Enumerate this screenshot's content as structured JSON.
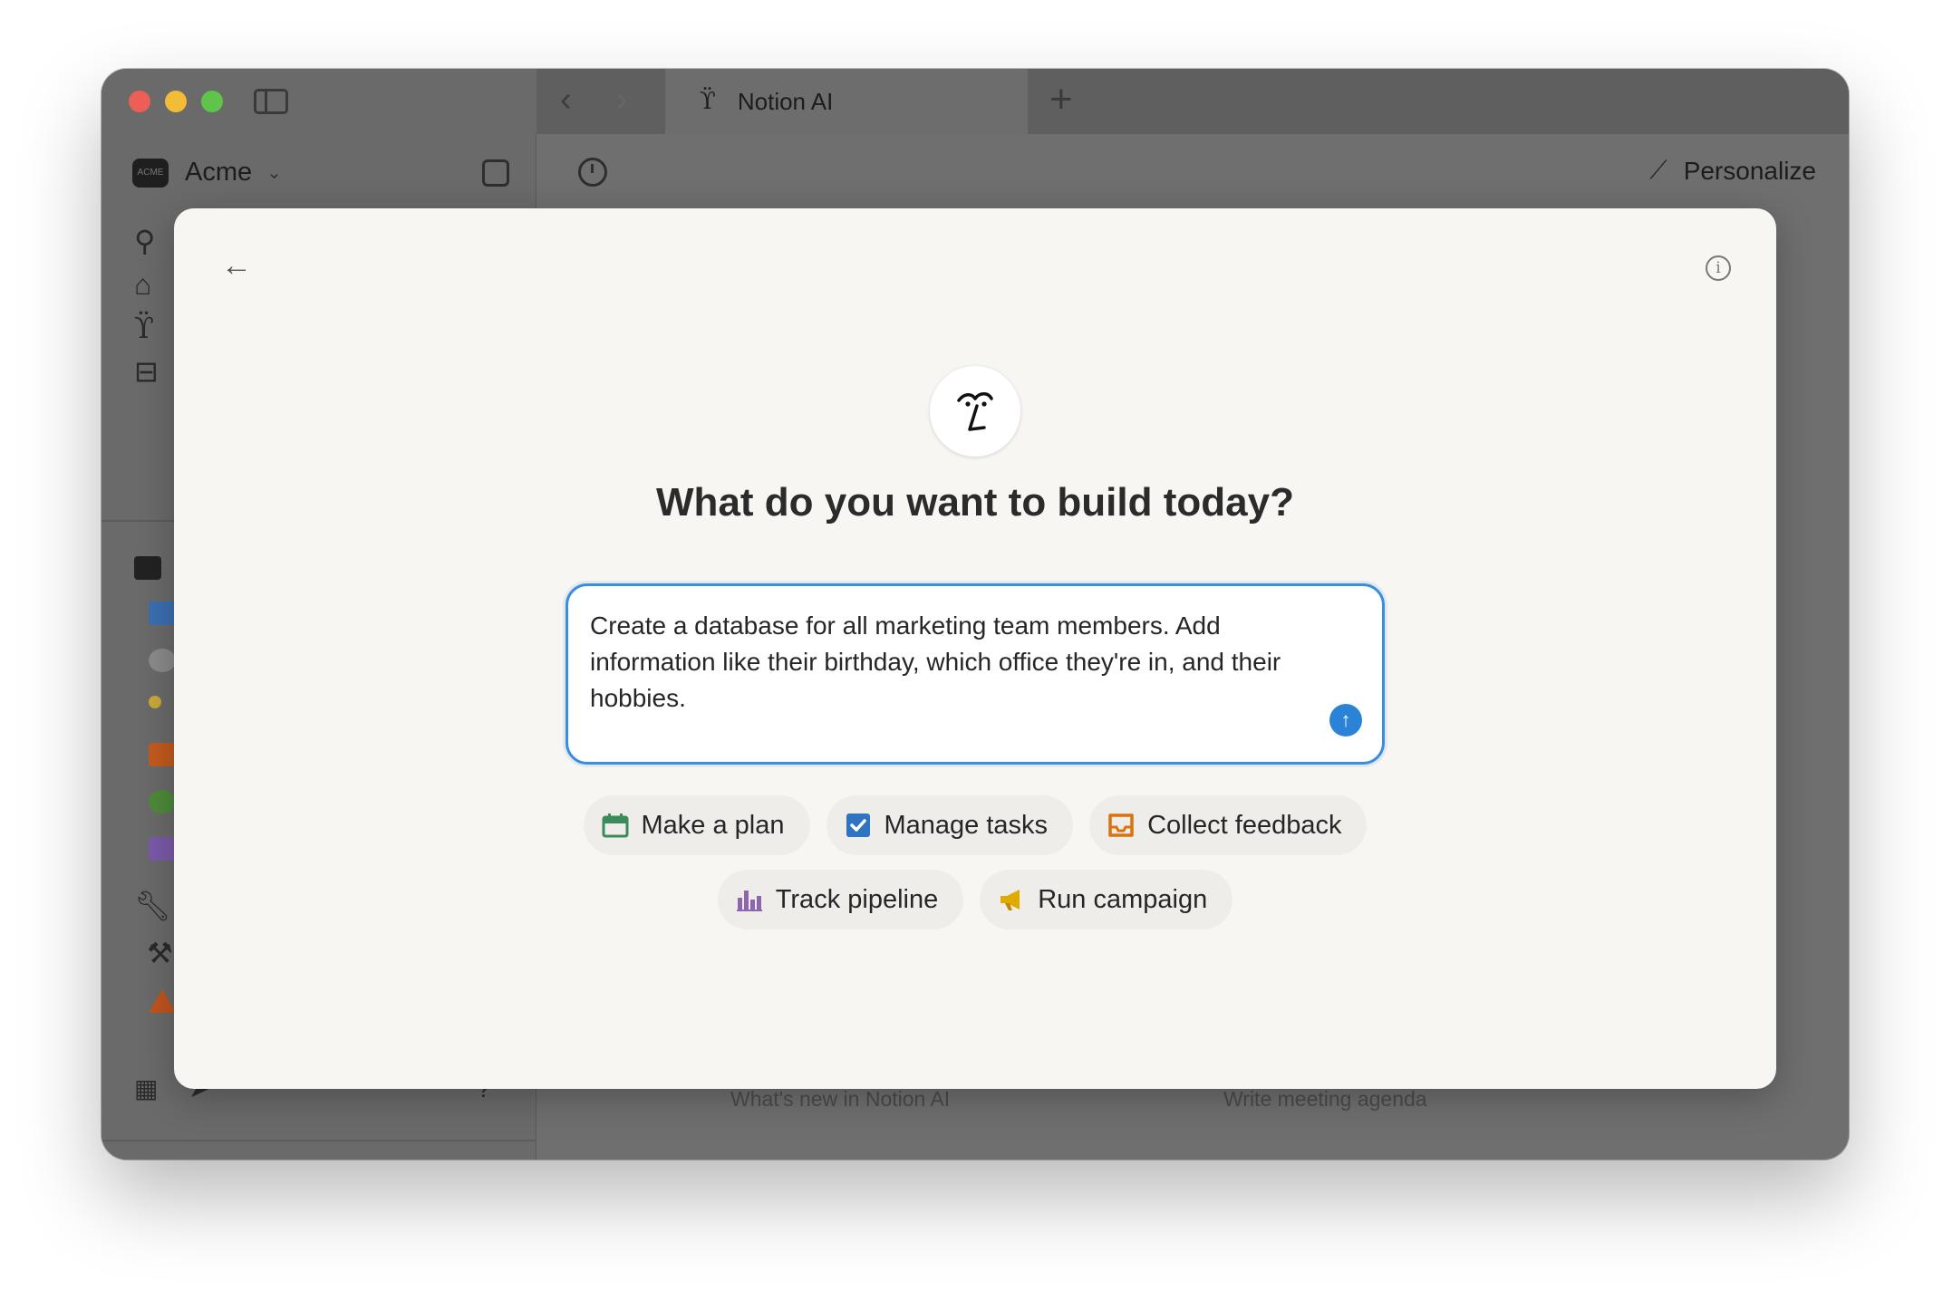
{
  "titlebar": {
    "tab_title": "Notion AI",
    "tab_icon": "notion-ai-face-icon"
  },
  "sidebar": {
    "workspace_name": "Acme",
    "workspace_logo_text": "ACME"
  },
  "header": {
    "personalize_label": "Personalize"
  },
  "background_cards": [
    {
      "label": "What's new in Notion AI"
    },
    {
      "label": "Write meeting agenda"
    }
  ],
  "modal": {
    "title": "What do you want to build today?",
    "prompt_text": "Create a database for all marketing team members. Add information like their birthday, which office they're in, and their hobbies.",
    "send_icon": "arrow-up-icon",
    "chips": [
      {
        "label": "Make a plan",
        "icon": "calendar-icon",
        "color": "#3b8a5a"
      },
      {
        "label": "Manage tasks",
        "icon": "checkbox-icon",
        "color": "#2f74c0"
      },
      {
        "label": "Collect feedback",
        "icon": "inbox-icon",
        "color": "#d9730d"
      },
      {
        "label": "Track pipeline",
        "icon": "bar-chart-icon",
        "color": "#9065b0"
      },
      {
        "label": "Run campaign",
        "icon": "megaphone-icon",
        "color": "#dfab01"
      }
    ]
  },
  "colors": {
    "accent": "#2a83d6",
    "modal_bg": "#f7f6f3",
    "overlay": "#6f6f6f"
  }
}
